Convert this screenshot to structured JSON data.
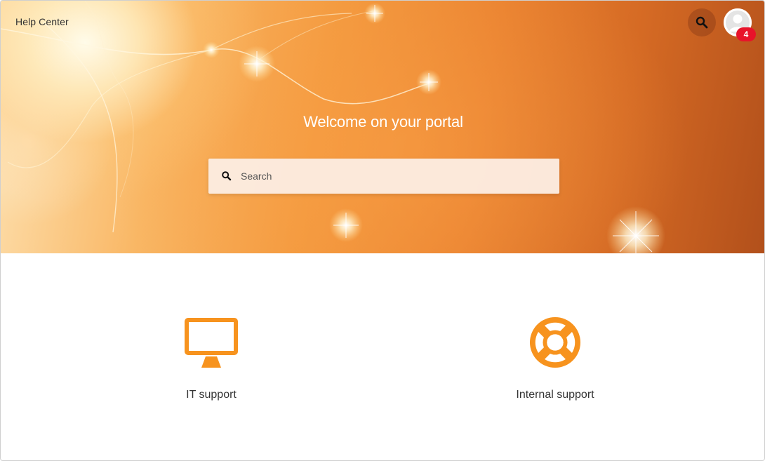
{
  "header": {
    "brand": "Help Center",
    "search_icon": "search-icon",
    "avatar_icon": "user-avatar-icon",
    "notification_count": "4"
  },
  "hero": {
    "title": "Welcome on your portal",
    "search": {
      "placeholder": "Search",
      "value": "",
      "icon": "search-icon"
    }
  },
  "categories": [
    {
      "label": "IT support",
      "icon": "monitor-icon"
    },
    {
      "label": "Internal support",
      "icon": "lifebuoy-icon"
    }
  ],
  "colors": {
    "accent": "#f7931e",
    "badge": "#e8132a",
    "hero_dark": "#b2501b",
    "hero_light": "#fde2b2"
  }
}
